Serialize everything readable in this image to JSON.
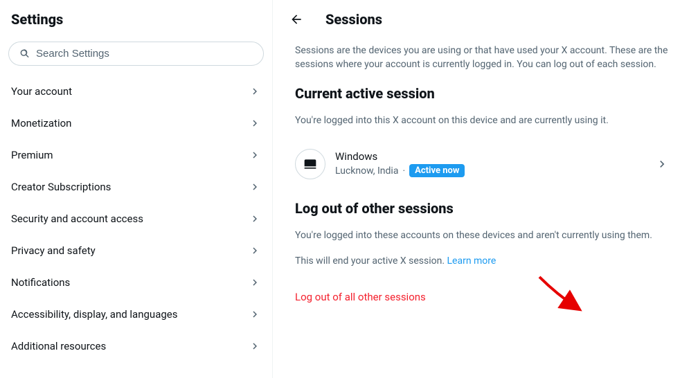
{
  "left": {
    "title": "Settings",
    "search_placeholder": "Search Settings",
    "items": [
      {
        "label": "Your account"
      },
      {
        "label": "Monetization"
      },
      {
        "label": "Premium"
      },
      {
        "label": "Creator Subscriptions"
      },
      {
        "label": "Security and account access"
      },
      {
        "label": "Privacy and safety"
      },
      {
        "label": "Notifications"
      },
      {
        "label": "Accessibility, display, and languages"
      },
      {
        "label": "Additional resources"
      }
    ]
  },
  "right": {
    "title": "Sessions",
    "description": "Sessions are the devices you are using or that have used your X account. These are the sessions where your account is currently logged in. You can log out of each session.",
    "current_section": "Current active session",
    "current_desc": "You're logged into this X account on this device and are currently using it.",
    "session": {
      "os": "Windows",
      "location": "Lucknow, India",
      "separator": "·",
      "badge": "Active now"
    },
    "other_section": "Log out of other sessions",
    "other_desc": "You're logged into these accounts on these devices and aren't currently using them.",
    "end_session_text": "This will end your active X session. ",
    "learn_more": "Learn more",
    "logout_all": "Log out of all other sessions"
  }
}
